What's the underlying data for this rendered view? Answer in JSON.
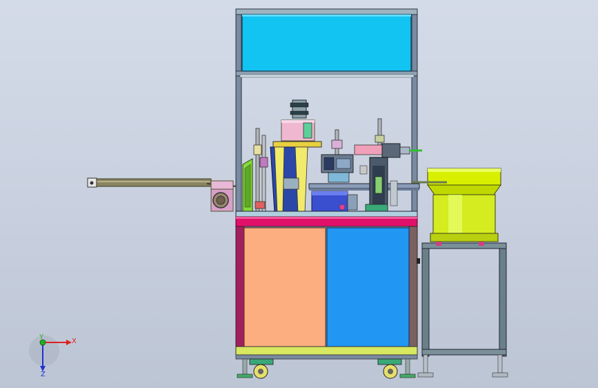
{
  "viewport": {
    "background_top": "#d4dbe8",
    "background_bottom": "#bcc5d4"
  },
  "machine": {
    "frame_color": "#7a8aa0",
    "top_panel_color": "#12c4f2",
    "left_door_color": "#fcae80",
    "right_door_color": "#2196f3",
    "base_rail_color": "#e0106a",
    "feeder_bowl_color": "#d8f000",
    "cylinder_color": "#f4f06a"
  },
  "triad": {
    "x_label": "X",
    "y_label": "Y",
    "z_label": "Z",
    "x_color": "#e02020",
    "y_color": "#20b020",
    "z_color": "#2030d0"
  }
}
